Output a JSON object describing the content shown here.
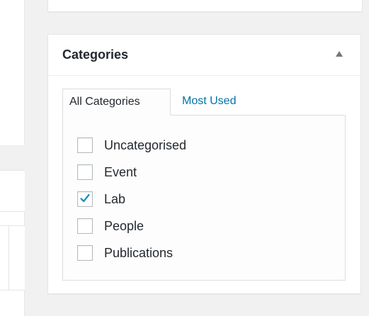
{
  "metabox": {
    "title": "Categories",
    "toggle_icon": "triangle-up-icon"
  },
  "tabs": [
    {
      "label": "All Categories",
      "active": true
    },
    {
      "label": "Most Used",
      "active": false
    }
  ],
  "categories": [
    {
      "label": "Uncategorised",
      "checked": false
    },
    {
      "label": "Event",
      "checked": false
    },
    {
      "label": "Lab",
      "checked": true
    },
    {
      "label": "People",
      "checked": false
    },
    {
      "label": "Publications",
      "checked": false
    }
  ],
  "colors": {
    "link": "#0073aa",
    "check": "#1e8cbe",
    "text": "#23282d",
    "background": "#f1f1f1"
  }
}
